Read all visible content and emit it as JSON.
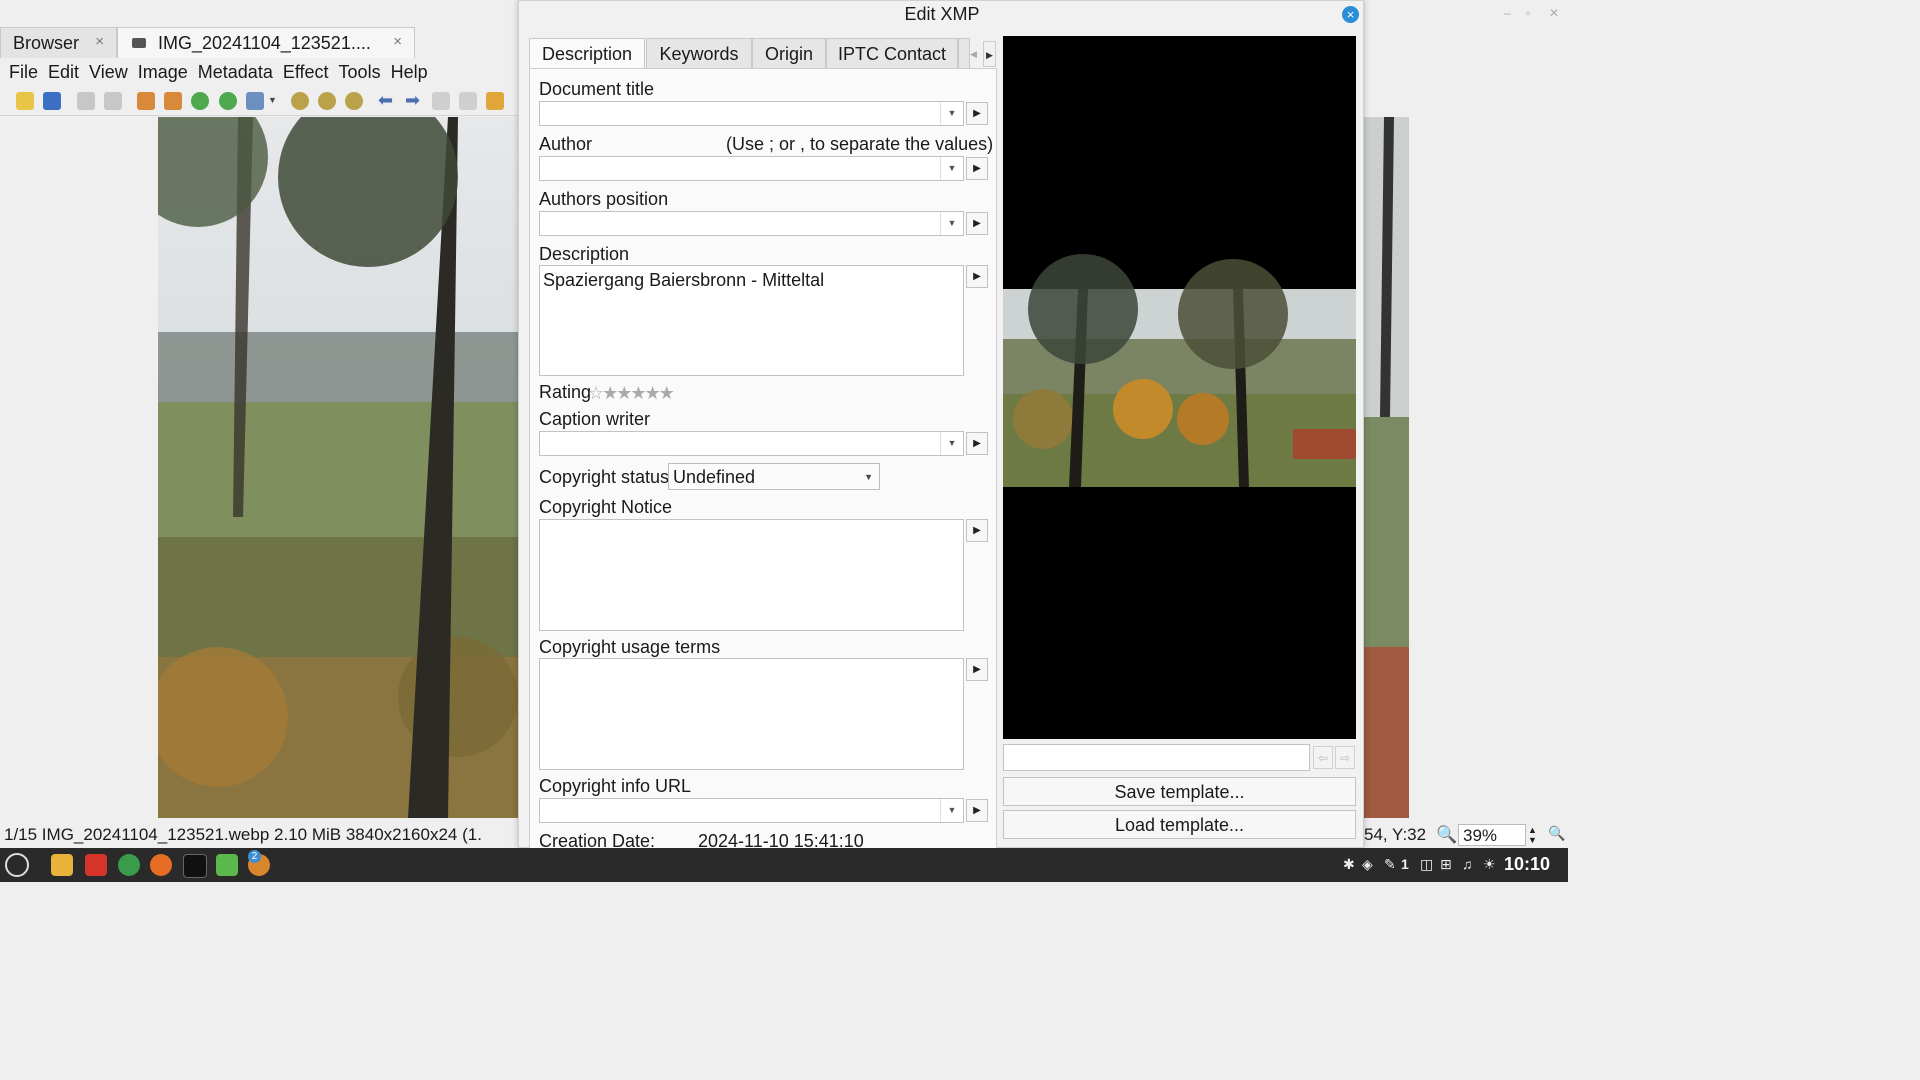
{
  "app": {
    "tabs": [
      {
        "label": "Browser",
        "close": "×"
      },
      {
        "label": "IMG_20241104_123521....",
        "close": "×"
      }
    ],
    "menu": [
      "File",
      "Edit",
      "View",
      "Image",
      "Metadata",
      "Effect",
      "Tools",
      "Help"
    ],
    "status": {
      "left": "1/15  IMG_20241104_123521.webp  2.10 MiB  3840x2160x24  (1.",
      "coords": "54, Y:32",
      "zoom": "39%"
    }
  },
  "dialog": {
    "title": "Edit XMP",
    "close": "×",
    "tabs": [
      "Description",
      "Keywords",
      "Origin",
      "IPTC Contact"
    ],
    "fields": {
      "document_title": {
        "label": "Document title",
        "value": ""
      },
      "author": {
        "label": "Author",
        "hint": "(Use ; or , to separate the values)",
        "value": ""
      },
      "authors_position": {
        "label": "Authors position",
        "value": ""
      },
      "description": {
        "label": "Description",
        "value": "Spaziergang Baiersbronn - Mitteltal"
      },
      "rating": {
        "label": "Rating",
        "stars": "☆★★★★★",
        "value": 0,
        "max": 5
      },
      "caption_writer": {
        "label": "Caption writer",
        "value": ""
      },
      "copyright_status": {
        "label": "Copyright status",
        "value": "Undefined"
      },
      "copyright_notice": {
        "label": "Copyright Notice",
        "value": ""
      },
      "copyright_usage": {
        "label": "Copyright usage terms",
        "value": ""
      },
      "copyright_url": {
        "label": "Copyright info URL",
        "value": ""
      },
      "creation_date": {
        "label": "Creation Date:",
        "value": "2024-11-10 15:41:10"
      }
    },
    "buttons": {
      "save_template": "Save template...",
      "load_template": "Load template..."
    }
  },
  "taskbar": {
    "clock": "10:10",
    "badge": "2",
    "workspace": "1"
  }
}
